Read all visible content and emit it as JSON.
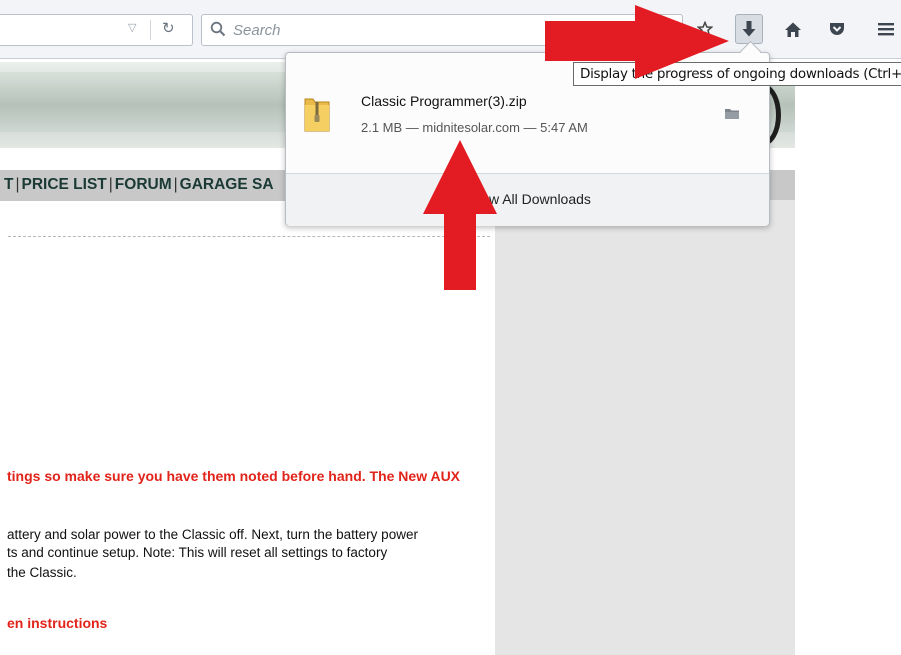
{
  "toolbar": {
    "search_placeholder": "Search",
    "download_tooltip": "Display the progress of ongoing downloads (Ctrl+J)"
  },
  "page": {
    "nav_links": [
      "T",
      "PRICE LIST",
      "FORUM",
      "GARAGE SA"
    ],
    "red_text_1": "tings so make sure you have them noted before hand. The New AUX",
    "body_line_1": "attery and solar power to the Classic off. Next, turn the battery power",
    "body_line_2": "ts and continue setup. Note: This will reset all settings to factory",
    "body_line_3": " the Classic.",
    "red_text_2": "en instructions"
  },
  "downloads_panel": {
    "items": [
      {
        "file_name": "Classic Programmer(3).zip",
        "meta": "2.1 MB — midnitesolar.com — 5:47 AM",
        "icon": "zip-folder-icon"
      }
    ],
    "show_all_label": "Show All Downloads"
  },
  "colors": {
    "annotation_red": "#e31b23",
    "link_text": "#1b3a35",
    "red_text": "#e2231a"
  }
}
